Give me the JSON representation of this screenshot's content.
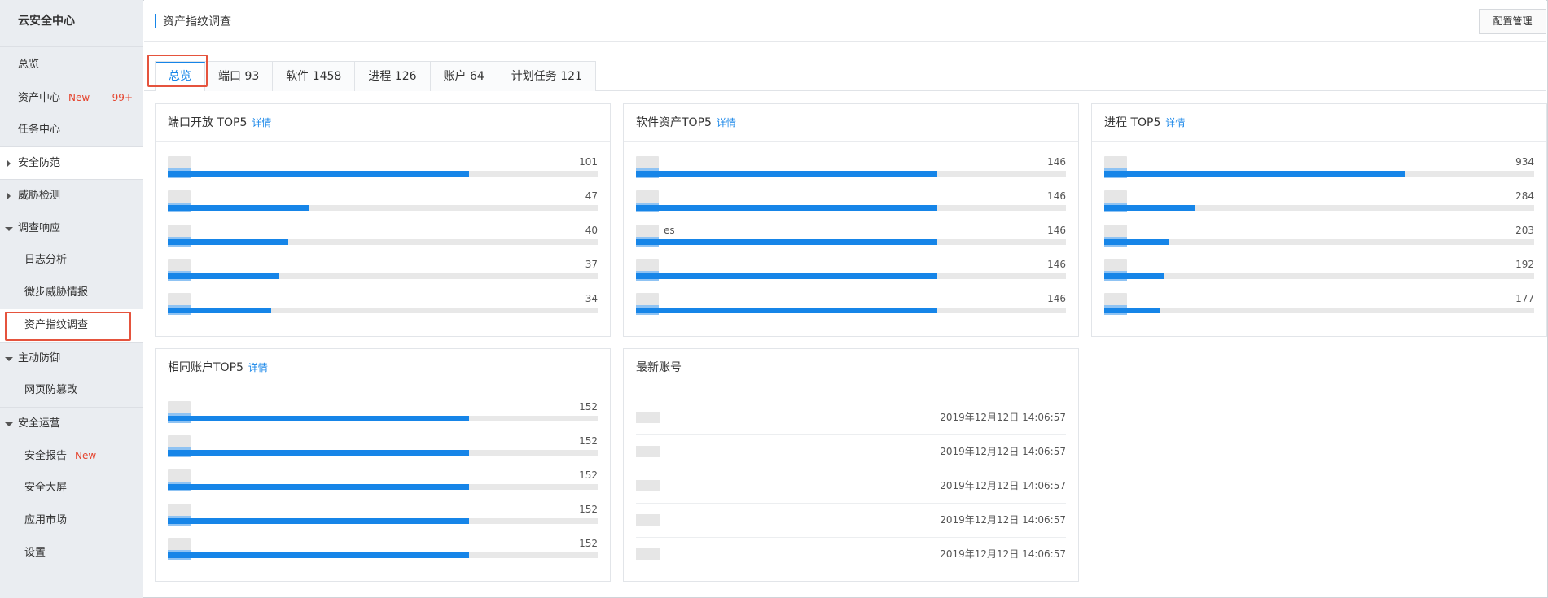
{
  "sidebar": {
    "title": "云安全中心",
    "top_items": [
      {
        "label": "总览"
      },
      {
        "label": "资产中心",
        "badge": "New",
        "count": "99+"
      },
      {
        "label": "任务中心"
      }
    ],
    "groups": {
      "defense": "安全防范",
      "threat": "威胁检测",
      "investigation": "调查响应",
      "active_defense": "主动防御",
      "ops": "安全运营"
    },
    "investigation_items": [
      "日志分析",
      "微步威胁情报",
      "资产指纹调查"
    ],
    "active_defense_items": [
      "网页防篡改"
    ],
    "ops_items": [
      {
        "label": "安全报告",
        "badge": "New"
      },
      {
        "label": "安全大屏"
      },
      {
        "label": "应用市场"
      },
      {
        "label": "设置"
      }
    ]
  },
  "header": {
    "title": "资产指纹调查",
    "config_button": "配置管理"
  },
  "tabs": [
    "总览",
    "端口 93",
    "软件 1458",
    "进程 126",
    "账户 64",
    "计划任务 121"
  ],
  "detail_label": "详情",
  "cards": {
    "ports": {
      "title": "端口开放 TOP5",
      "values": [
        "101",
        "47",
        "40",
        "37",
        "34"
      ],
      "fractions": [
        0.7,
        0.33,
        0.28,
        0.26,
        0.24
      ]
    },
    "software": {
      "title": "软件资产TOP5",
      "values": [
        "146",
        "146",
        "146",
        "146",
        "146"
      ],
      "fractions": [
        0.7,
        0.7,
        0.7,
        0.7,
        0.7
      ],
      "partial_label": "es"
    },
    "process": {
      "title": "进程 TOP5",
      "values": [
        "934",
        "284",
        "203",
        "192",
        "177"
      ],
      "fractions": [
        0.7,
        0.21,
        0.15,
        0.14,
        0.13
      ]
    },
    "accounts": {
      "title": "相同账户TOP5",
      "values": [
        "152",
        "152",
        "152",
        "152",
        "152"
      ],
      "fractions": [
        0.7,
        0.7,
        0.7,
        0.7,
        0.7
      ]
    },
    "latest": {
      "title": "最新账号",
      "times": [
        "2019年12月12日 14:06:57",
        "2019年12月12日 14:06:57",
        "2019年12月12日 14:06:57",
        "2019年12月12日 14:06:57",
        "2019年12月12日 14:06:57"
      ]
    }
  }
}
